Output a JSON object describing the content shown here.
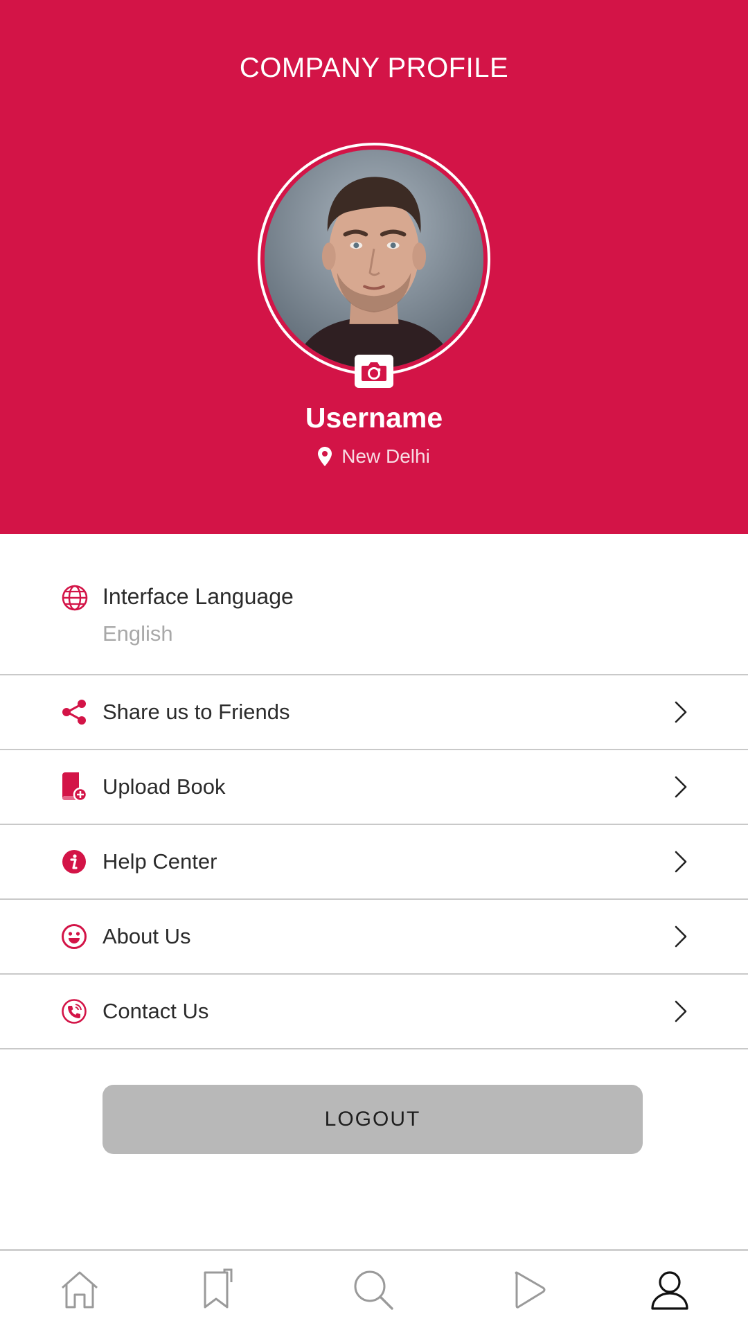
{
  "header": {
    "title": "COMPANY PROFILE",
    "username": "Username",
    "location": "New Delhi",
    "avatar_icon": "profile-photo",
    "camera_icon": "camera-icon",
    "location_icon": "map-pin-icon"
  },
  "language": {
    "label": "Interface Language",
    "value": "English",
    "icon": "globe-icon"
  },
  "menu": {
    "items": [
      {
        "label": "Share us to Friends",
        "icon": "share-icon"
      },
      {
        "label": "Upload Book",
        "icon": "upload-book-icon"
      },
      {
        "label": "Help Center",
        "icon": "info-icon"
      },
      {
        "label": "About Us",
        "icon": "smiley-icon"
      },
      {
        "label": "Contact Us",
        "icon": "phone-icon"
      }
    ]
  },
  "logout": {
    "label": "LOGOUT"
  },
  "bottom_nav": {
    "items": [
      {
        "icon": "home-icon",
        "active": false
      },
      {
        "icon": "bookmark-icon",
        "active": false
      },
      {
        "icon": "search-icon",
        "active": false
      },
      {
        "icon": "play-icon",
        "active": false
      },
      {
        "icon": "profile-icon",
        "active": true
      }
    ]
  },
  "colors": {
    "brand": "#d31447",
    "text": "#2b2b2b",
    "muted": "#a8a8a8",
    "divider": "#c9c9c9",
    "logout_bg": "#b8b8b8"
  }
}
